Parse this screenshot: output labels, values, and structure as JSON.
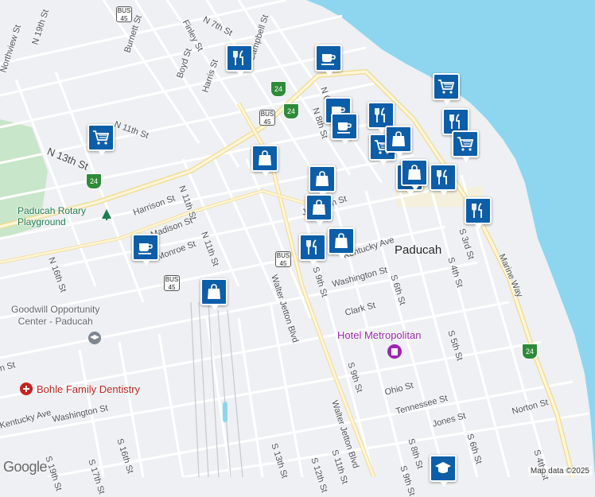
{
  "map": {
    "city_label": "Paducah",
    "water_color": "#8ed6ef",
    "land_color": "#eef0f3",
    "road_color": "#ffffff",
    "highway_color": "#fff6d9",
    "park_color": "#c8e6c9"
  },
  "streets": [
    {
      "name": "N 7th St"
    },
    {
      "name": "Finley St"
    },
    {
      "name": "Burnett St"
    },
    {
      "name": "N 19th St"
    },
    {
      "name": "Northview St"
    },
    {
      "name": "Boyd St"
    },
    {
      "name": "Harris St"
    },
    {
      "name": "Campbell St"
    },
    {
      "name": "N 11th St"
    },
    {
      "name": "N 13th St"
    },
    {
      "name": "N 11th St"
    },
    {
      "name": "Harrison St"
    },
    {
      "name": "N 11th St"
    },
    {
      "name": "Madison St"
    },
    {
      "name": "Monroe St"
    },
    {
      "name": "N 16th St"
    },
    {
      "name": "Jefferson St"
    },
    {
      "name": "Kentucky Ave"
    },
    {
      "name": "Walter Jetton Blvd"
    },
    {
      "name": "S 9th St"
    },
    {
      "name": "Washington St"
    },
    {
      "name": "S 6th St"
    },
    {
      "name": "S 4th St"
    },
    {
      "name": "S 3rd St"
    },
    {
      "name": "Marine Way"
    },
    {
      "name": "Clark St"
    },
    {
      "name": "S 5th St"
    },
    {
      "name": "S 9th St"
    },
    {
      "name": "Walter Jetton Blvd"
    },
    {
      "name": "Ohio St"
    },
    {
      "name": "Tennessee St"
    },
    {
      "name": "Norton St"
    },
    {
      "name": "S 8th St"
    },
    {
      "name": "Jones St"
    },
    {
      "name": "S 6th St"
    },
    {
      "name": "S 4th St"
    },
    {
      "name": "Washington St"
    },
    {
      "name": "Kentucky Ave"
    },
    {
      "name": "S 16th St"
    },
    {
      "name": "S 17th St"
    },
    {
      "name": "S 19th St"
    },
    {
      "name": "S 13th St"
    },
    {
      "name": "S 12th St"
    },
    {
      "name": "S 11th St"
    },
    {
      "name": "S 9th St"
    },
    {
      "name": "N 8th St"
    },
    {
      "name": "N 6th St"
    },
    {
      "name": "n St"
    }
  ],
  "places": [
    {
      "name": "Paducah Rotary\nPlayground",
      "line1": "Paducah Rotary",
      "line2": "Playground"
    },
    {
      "name": "Goodwill Opportunity Center - Paducah",
      "line1": "Goodwill Opportunity",
      "line2": "Center - Paducah"
    },
    {
      "name": "Hotel Metropolitan"
    },
    {
      "name": "Bohle Family Dentistry"
    }
  ],
  "shields": [
    {
      "type": "bus",
      "top": "BUS",
      "num": "45"
    },
    {
      "type": "int",
      "num": "24"
    },
    {
      "type": "int",
      "num": "24"
    },
    {
      "type": "bus",
      "top": "BUS",
      "num": "45"
    },
    {
      "type": "int",
      "num": "24"
    },
    {
      "type": "bus",
      "top": "BUS",
      "num": "45"
    },
    {
      "type": "bus",
      "top": "BUS",
      "num": "45"
    },
    {
      "type": "int",
      "num": "24"
    }
  ],
  "markers": [
    {
      "icon": "restaurant-icon"
    },
    {
      "icon": "coffee-icon"
    },
    {
      "icon": "grocery-cart-icon"
    },
    {
      "icon": "coffee-icon"
    },
    {
      "icon": "restaurant-icon"
    },
    {
      "icon": "coffee-icon"
    },
    {
      "icon": "grocery-cart-icon"
    },
    {
      "icon": "shopping-bag-icon"
    },
    {
      "icon": "grocery-cart-icon"
    },
    {
      "icon": "shopping-bag-icon"
    },
    {
      "icon": "shopping-bag-icon"
    },
    {
      "icon": "shopping-bag-icon"
    },
    {
      "icon": "restaurant-icon"
    },
    {
      "icon": "restaurant-icon"
    },
    {
      "icon": "shopping-bag-icon"
    },
    {
      "icon": "restaurant-icon"
    },
    {
      "icon": "coffee-icon"
    },
    {
      "icon": "shopping-bag-icon"
    },
    {
      "icon": "shopping-bag-icon"
    },
    {
      "icon": "restaurant-icon"
    },
    {
      "icon": "restaurant-icon"
    },
    {
      "icon": "grocery-cart-icon"
    },
    {
      "icon": "school-icon"
    }
  ],
  "attribution": {
    "logo": "Google",
    "map_data": "Map data ©2025"
  }
}
